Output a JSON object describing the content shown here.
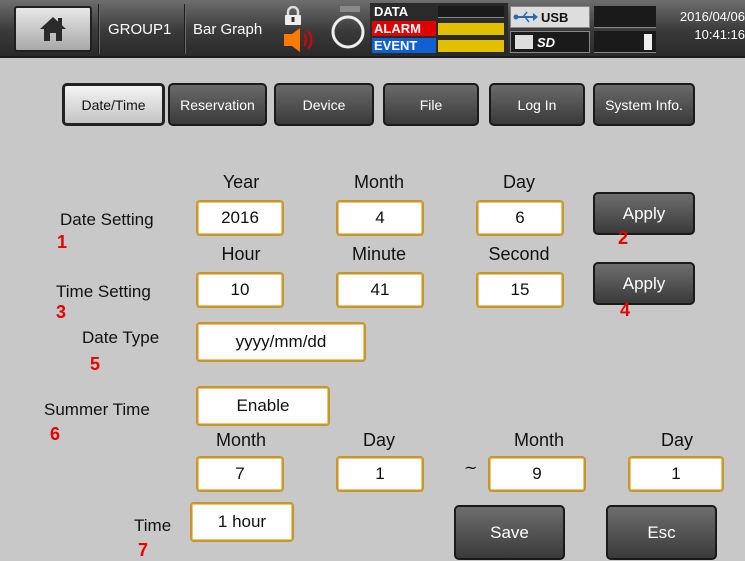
{
  "topbar": {
    "group": "GROUP1",
    "view": "Bar Graph",
    "status": [
      {
        "name": "DATA",
        "color": "#ffffff",
        "bg": "#2a2a2a"
      },
      {
        "name": "ALARM",
        "color": "#ffffff",
        "bg": "#e00000"
      },
      {
        "name": "EVENT",
        "color": "#ffffff",
        "bg": "#1060d0"
      }
    ],
    "usb_label": "USB",
    "date": "2016/04/06",
    "time": "10:41:16"
  },
  "tabs": [
    {
      "label": "Date/Time",
      "active": true
    },
    {
      "label": "Reservation"
    },
    {
      "label": "Device"
    },
    {
      "label": "File"
    },
    {
      "label": "Log In"
    },
    {
      "label": "System Info."
    }
  ],
  "date_setting": {
    "label": "Date Setting",
    "headers": {
      "year": "Year",
      "month": "Month",
      "day": "Day"
    },
    "year": "2016",
    "month": "4",
    "day": "6",
    "apply": "Apply"
  },
  "time_setting": {
    "label": "Time Setting",
    "headers": {
      "hour": "Hour",
      "minute": "Minute",
      "second": "Second"
    },
    "hour": "10",
    "minute": "41",
    "second": "15",
    "apply": "Apply"
  },
  "date_type": {
    "label": "Date Type",
    "value": "yyyy/mm/dd"
  },
  "summer_time": {
    "label": "Summer Time",
    "value": "Enable",
    "start_month_header": "Month",
    "start_day_header": "Day",
    "end_month_header": "Month",
    "end_day_header": "Day",
    "start_month": "7",
    "start_day": "1",
    "separator": "~",
    "end_month": "9",
    "end_day": "1",
    "time_label": "Time",
    "time_value": "1 hour"
  },
  "actions": {
    "save": "Save",
    "esc": "Esc"
  },
  "markers": [
    "1",
    "2",
    "3",
    "4",
    "5",
    "6",
    "7"
  ]
}
